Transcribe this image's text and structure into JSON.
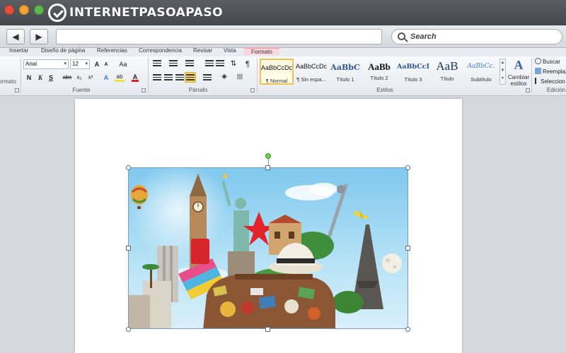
{
  "browser": {
    "logo_text_a": "INTERNET",
    "logo_text_b": "PASO",
    "logo_text_c": "A",
    "logo_text_d": "PASO",
    "back_label": "◀",
    "forward_label": "▶",
    "search_placeholder": "Search"
  },
  "tabs": [
    "Insertar",
    "Diseño de página",
    "Referencias",
    "Correspondencia",
    "Revisar",
    "Vista",
    "Formato"
  ],
  "ribbon": {
    "formato_fragment": "ormato",
    "font": {
      "name": "Arial",
      "size": "12",
      "group_label": "Fuente",
      "grow": "A",
      "shrink": "A",
      "change_case": "Aa",
      "bold": "N",
      "italic": "K",
      "underline": "S",
      "strike": "abc",
      "subscript": "x₂",
      "superscript": "x²",
      "effects": "A",
      "highlight": "ab",
      "color": "A"
    },
    "paragraph": {
      "group_label": "Párrafo",
      "show_marks": "¶"
    },
    "styles": {
      "group_label": "Estilos",
      "items": [
        {
          "sample": "AaBbCcDc",
          "name": "¶ Normal"
        },
        {
          "sample": "AaBbCcDc",
          "name": "¶ Sin espa..."
        },
        {
          "sample": "AaBbC",
          "name": "Título 1"
        },
        {
          "sample": "AaBb",
          "name": "Título 2"
        },
        {
          "sample": "AaBbCcI",
          "name": "Título 3"
        },
        {
          "sample": "AaB",
          "name": "Título"
        },
        {
          "sample": "AaBbCc.",
          "name": "Subtítulo"
        }
      ],
      "change_styles_icon": "A",
      "change_styles_label": "Cambiar estilos"
    },
    "editing": {
      "group_label": "Edición",
      "find": "Buscar",
      "replace": "Reemplaz",
      "select": "Seleccion"
    }
  },
  "colors": {
    "accent_formato": "#fbd7da",
    "selected_style_border": "#f0c24d"
  }
}
